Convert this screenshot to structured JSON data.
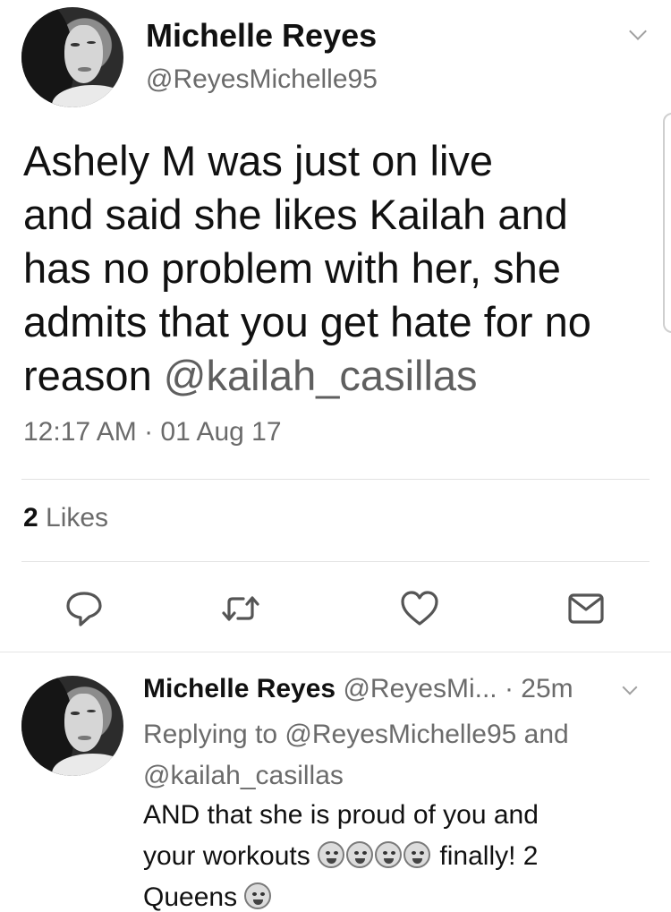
{
  "main_tweet": {
    "author_name": "Michelle Reyes",
    "author_handle": "@ReyesMichelle95",
    "text_line1": "Ashely M was just on live",
    "text_line2": "and said she likes Kailah and",
    "text_line3": "has no problem with her, she",
    "text_line4": "admits that you get hate for no",
    "text_line5_prefix": "reason ",
    "text_mention": "@kailah_casillas",
    "timestamp": "12:17 AM · 01 Aug 17",
    "likes_count": "2",
    "likes_label": " Likes",
    "icons": [
      "reply-icon",
      "retweet-icon",
      "heart-icon",
      "message-icon",
      "chevron-down-icon"
    ]
  },
  "reply_tweet": {
    "author_name": "Michelle Reyes",
    "meta": " @ReyesMi... · 25m",
    "replying_prefix": "Replying to @ReyesMichelle95 and",
    "replying_mention": "@kailah_casillas",
    "text_line1": "AND that she is proud of you and",
    "text_line2_a": "your workouts ",
    "text_line2_b": " finally! 2",
    "text_line3": "Queens ",
    "emojis": [
      "crying-face-icon",
      "crying-face-icon",
      "praying-face-icon",
      "praying-face-icon",
      "dizzy-face-icon"
    ]
  },
  "colors": {
    "text": "#111111",
    "secondary": "#6b6b6b",
    "divider": "#e2e2e2",
    "background": "#ffffff"
  }
}
